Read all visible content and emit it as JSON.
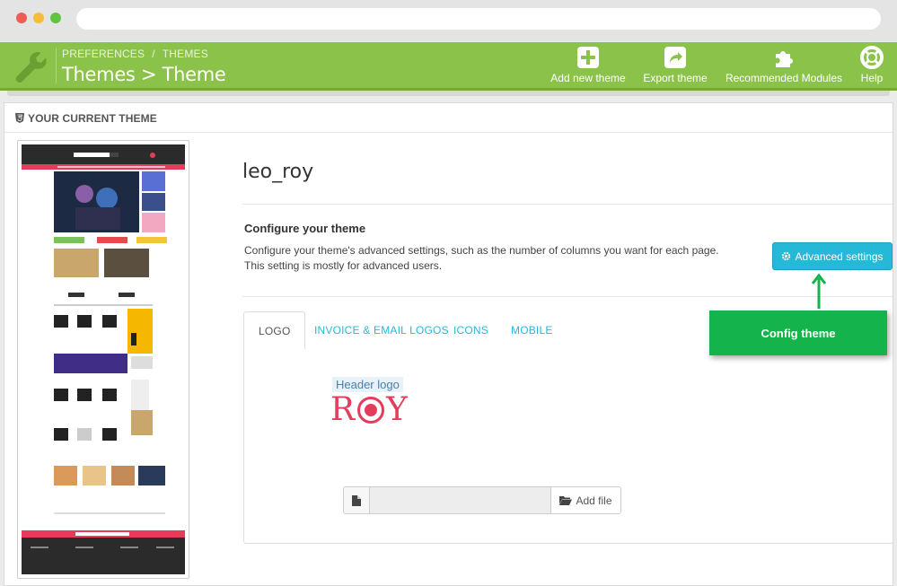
{
  "toolbar": {
    "breadcrumb": [
      "PREFERENCES",
      "THEMES"
    ],
    "breadcrumb_separator": "/",
    "title": "Themes > Theme",
    "buttons": [
      {
        "label": "Add new theme",
        "icon": "plus-square-icon"
      },
      {
        "label": "Export theme",
        "icon": "share-icon"
      },
      {
        "label": "Recommended Modules",
        "icon": "puzzle-icon"
      },
      {
        "label": "Help",
        "icon": "lifebuoy-icon"
      }
    ],
    "color": "#8bc34a"
  },
  "panel": {
    "heading": "YOUR CURRENT THEME",
    "theme_name": "leo_roy",
    "configure": {
      "title": "Configure your theme",
      "description_line1": "Configure your theme's advanced settings, such as the number of columns you want for each page.",
      "description_line2": "This setting is mostly for advanced users.",
      "button_label": "Advanced settings"
    },
    "annotation": "Config theme",
    "tabs": [
      {
        "label": "LOGO",
        "active": true
      },
      {
        "label": "INVOICE & EMAIL LOGOS",
        "active": false
      },
      {
        "label": "ICONS",
        "active": false
      },
      {
        "label": "MOBILE",
        "active": false
      }
    ],
    "logo": {
      "label": "Header logo",
      "brand": "ROY",
      "brand_left": "R",
      "brand_right": "Y",
      "add_file_label": "Add file"
    }
  },
  "colors": {
    "accent": "#25b9d7",
    "callout": "#14b34b",
    "brand": "#e63c5b"
  }
}
